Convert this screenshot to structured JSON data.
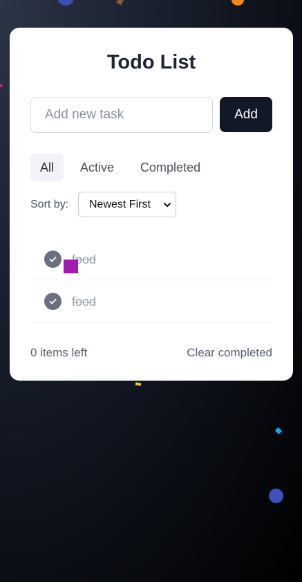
{
  "app": {
    "title": "Todo List"
  },
  "new_task": {
    "placeholder": "Add new task",
    "value": "",
    "add_label": "Add"
  },
  "filters": {
    "all": "All",
    "active": "Active",
    "completed": "Completed",
    "selected": "All"
  },
  "sort": {
    "label": "Sort by:",
    "selected": "Newest First"
  },
  "todos": [
    {
      "text": "food",
      "completed": true
    },
    {
      "text": "food",
      "completed": true
    }
  ],
  "footer": {
    "items_left": "0 items left",
    "clear_completed": "Clear completed"
  },
  "colors": {
    "add_button": "#111827",
    "check_done": "#6b7080",
    "card": "#ffffff"
  },
  "icons": {
    "check": "check-icon",
    "select_arrow": "chevron-down-icon"
  }
}
